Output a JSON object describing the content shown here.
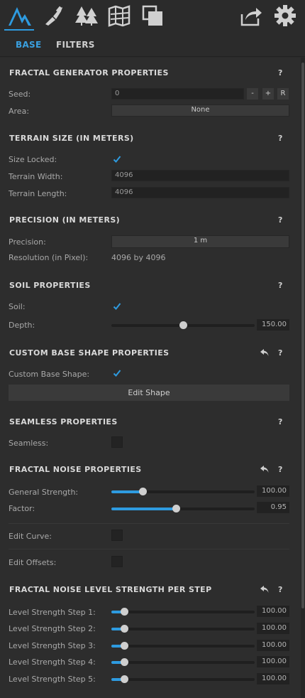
{
  "toolbar": {
    "icons": [
      "terrain-mountain-icon",
      "brush-icon",
      "trees-icon",
      "map-icon",
      "layers-icon",
      "export-icon",
      "gear-icon"
    ],
    "accent": "#2e9be0"
  },
  "tabs": [
    {
      "label": "BASE",
      "active": true
    },
    {
      "label": "FILTERS",
      "active": false
    }
  ],
  "fractal": {
    "title": "FRACTAL GENERATOR PROPERTIES",
    "help": "?",
    "seed_label": "Seed:",
    "seed_value": "0",
    "btn_minus": "-",
    "btn_plus": "+",
    "btn_r": "R",
    "area_label": "Area:",
    "area_value": "None"
  },
  "terrain": {
    "title": "TERRAIN SIZE (IN METERS)",
    "help": "?",
    "locked_label": "Size Locked:",
    "locked": true,
    "width_label": "Terrain Width:",
    "width_value": "4096",
    "length_label": "Terrain Length:",
    "length_value": "4096"
  },
  "precision": {
    "title": "PRECISION (IN METERS)",
    "help": "?",
    "precision_label": "Precision:",
    "precision_value": "1 m",
    "resolution_label": "Resolution (in Pixel):",
    "resolution_value": "4096 by 4096"
  },
  "soil": {
    "title": "SOIL PROPERTIES",
    "help": "?",
    "soil_label": "Soil:",
    "soil_checked": true,
    "depth_label": "Depth:",
    "depth_value": "150.00",
    "depth_fraction": 0.5
  },
  "custom_shape": {
    "title": "CUSTOM BASE SHAPE PROPERTIES",
    "help": "?",
    "label": "Custom Base Shape:",
    "checked": true,
    "edit_button": "Edit Shape"
  },
  "seamless": {
    "title": "SEAMLESS PROPERTIES",
    "help": "?",
    "label": "Seamless:",
    "checked": false
  },
  "noise": {
    "title": "FRACTAL NOISE PROPERTIES",
    "help": "?",
    "strength_label": "General Strength:",
    "strength_value": "100.00",
    "strength_fraction": 0.22,
    "factor_label": "Factor:",
    "factor_value": "0.95",
    "factor_fraction": 0.45,
    "edit_curve_label": "Edit Curve:",
    "edit_offsets_label": "Edit Offsets:"
  },
  "level_strength": {
    "title": "FRACTAL NOISE LEVEL STRENGTH PER STEP",
    "help": "?",
    "steps": [
      {
        "label": "Level Strength Step 1:",
        "value": "100.00",
        "fraction": 0.09
      },
      {
        "label": "Level Strength Step 2:",
        "value": "100.00",
        "fraction": 0.09
      },
      {
        "label": "Level Strength Step 3:",
        "value": "100.00",
        "fraction": 0.09
      },
      {
        "label": "Level Strength Step 4:",
        "value": "100.00",
        "fraction": 0.09
      },
      {
        "label": "Level Strength Step 5:",
        "value": "100.00",
        "fraction": 0.09
      }
    ]
  }
}
